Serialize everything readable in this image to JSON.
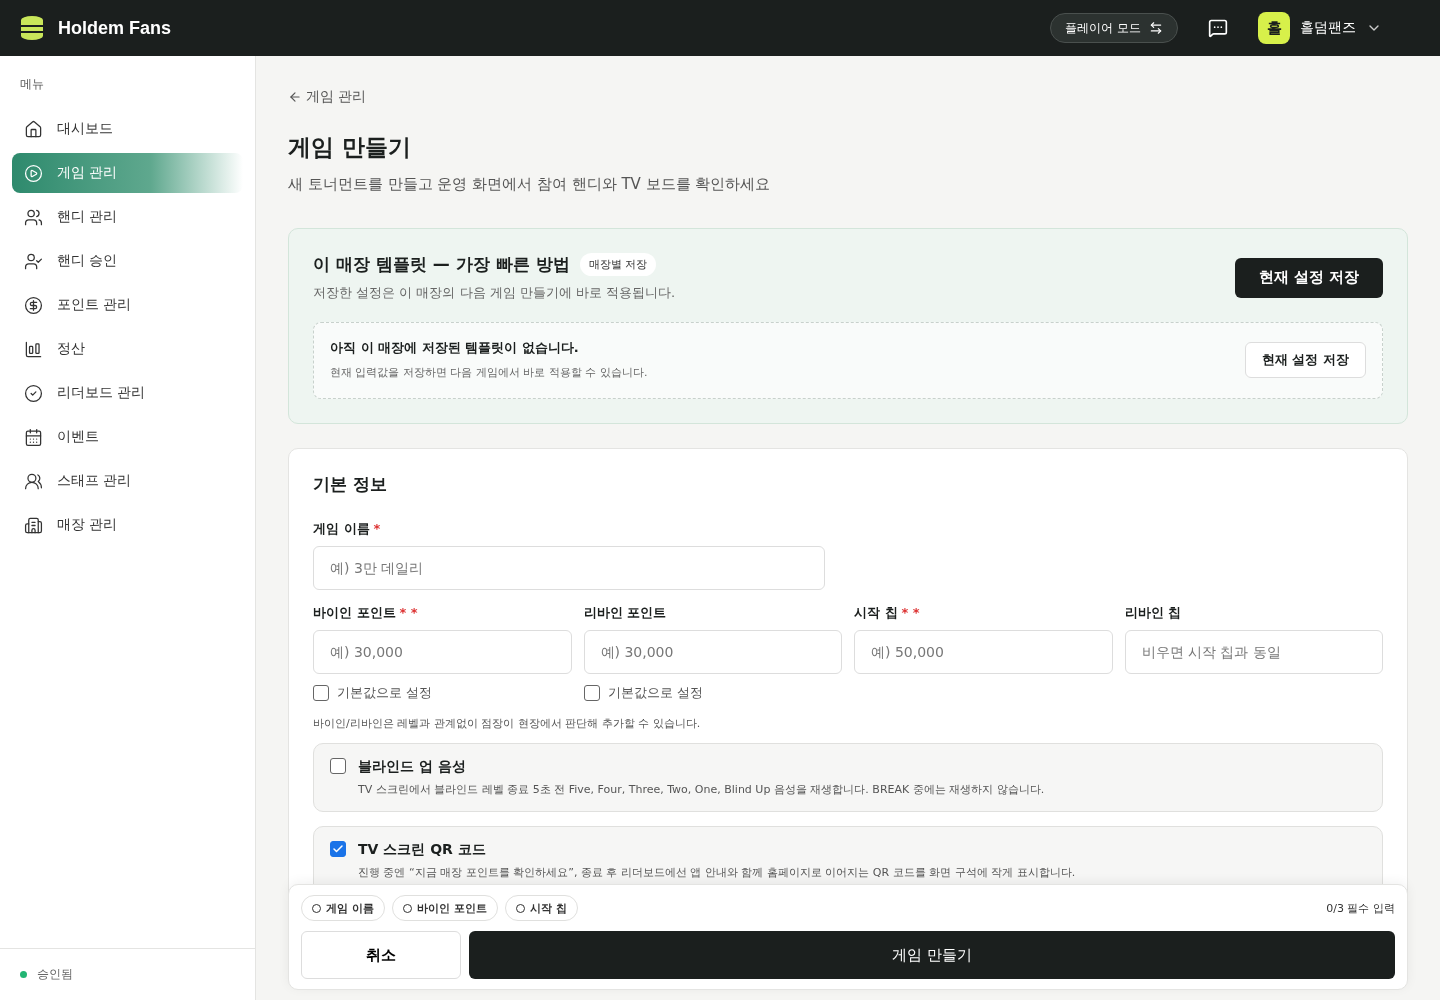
{
  "header": {
    "brand": "Holdem Fans",
    "mode_button": "플레이어 모드",
    "avatar_initial": "홀",
    "user_name": "홀덤팬즈"
  },
  "sidebar": {
    "heading": "메뉴",
    "items": [
      {
        "label": "대시보드",
        "selected": false
      },
      {
        "label": "게임 관리",
        "selected": true
      },
      {
        "label": "핸디 관리",
        "selected": false
      },
      {
        "label": "핸디 승인",
        "selected": false
      },
      {
        "label": "포인트 관리",
        "selected": false
      },
      {
        "label": "정산",
        "selected": false
      },
      {
        "label": "리더보드 관리",
        "selected": false
      },
      {
        "label": "이벤트",
        "selected": false
      },
      {
        "label": "스태프 관리",
        "selected": false
      },
      {
        "label": "매장 관리",
        "selected": false
      }
    ],
    "status": {
      "label": "승인됨",
      "color": "#22b573"
    }
  },
  "page": {
    "back_link": "게임 관리",
    "title": "게임 만들기",
    "subtitle": "새 토너먼트를 만들고 운영 화면에서 참여 핸디와 TV 보드를 확인하세요"
  },
  "template": {
    "title": "이 매장 템플릿 — 가장 빠른 방법",
    "badge": "매장별 저장",
    "description": "저장한 설정은 이 매장의 다음 게임 만들기에 바로 적용됩니다.",
    "save_button": "현재 설정 저장",
    "empty": {
      "title": "아직 이 매장에 저장된 템플릿이 없습니다.",
      "description": "현재 입력값을 저장하면 다음 게임에서 바로 적용할 수 있습니다.",
      "button": "현재 설정 저장"
    }
  },
  "basic_info": {
    "title": "기본 정보",
    "game_name": {
      "label": "게임 이름",
      "marker": "*",
      "placeholder": "예) 3만 데일리"
    },
    "fields": [
      {
        "label": "바이인 포인트",
        "marker": "* *",
        "placeholder": "예) 30,000",
        "default_checkbox": {
          "label": "기본값으로 설정",
          "checked": false
        }
      },
      {
        "label": "리바인 포인트",
        "placeholder": "예) 30,000",
        "default_checkbox": {
          "label": "기본값으로 설정",
          "checked": false
        }
      },
      {
        "label": "시작 칩",
        "marker": "* *",
        "placeholder": "예) 50,000"
      },
      {
        "label": "리바인 칩",
        "placeholder": "비우면 시작 칩과 동일"
      }
    ],
    "note": "바이인/리바인은 레벨과 관계없이 점장이 현장에서 판단해 추가할 수 있습니다.",
    "options": [
      {
        "title": "블라인드 업 음성",
        "description": "TV 스크린에서 블라인드 레벨 종료 5초 전 Five, Four, Three, Two, One, Blind Up 음성을 재생합니다. BREAK 중에는 재생하지 않습니다.",
        "checked": false
      },
      {
        "title": "TV 스크린 QR 코드",
        "description": "진행 중엔 “지금 매장 포인트를 확인하세요”, 종료 후 리더보드에선 앱 안내와 함께 홈페이지로 이어지는 QR 코드를 화면 구석에 작게 표시합니다.",
        "checked": true
      }
    ]
  },
  "footer": {
    "requirements": [
      {
        "label": "게임 이름",
        "done": false
      },
      {
        "label": "바이인 포인트",
        "done": false
      },
      {
        "label": "시작 칩",
        "done": false
      }
    ],
    "progress": "0/3 필수 입력",
    "cancel_button": "취소",
    "submit_button": "게임 만들기"
  }
}
